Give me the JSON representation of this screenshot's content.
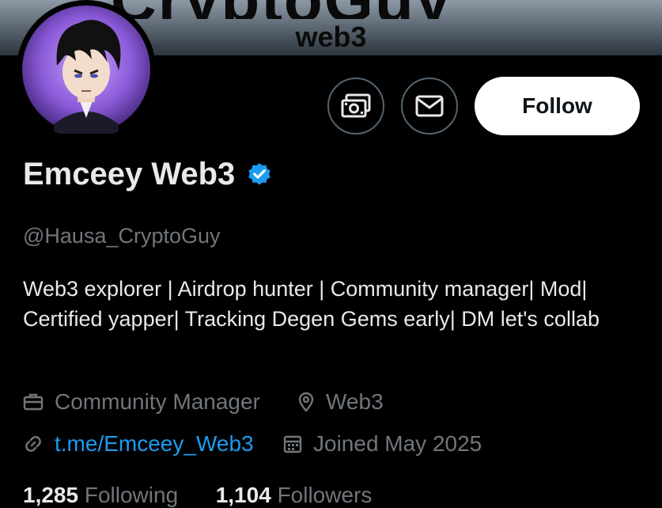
{
  "banner": {
    "headline": "CryptoGuy",
    "subtitle": "web3"
  },
  "profile": {
    "display_name": "Emceey Web3",
    "handle": "@Hausa_CryptoGuy",
    "bio": "Web3 explorer | Airdrop hunter | Community manager| Mod| Certified yapper| Tracking Degen Gems early| DM let's collab",
    "category": "Community Manager",
    "location": "Web3",
    "website": "t.me/Emceey_Web3",
    "joined": "Joined May 2025"
  },
  "actions": {
    "follow_label": "Follow"
  },
  "stats": {
    "following_count": "1,285",
    "following_label": "Following",
    "followers_count": "1,104",
    "followers_label": "Followers"
  },
  "icons": {
    "tip": "money-icon",
    "message": "envelope-icon",
    "verified": "verified-badge-icon",
    "category": "briefcase-icon",
    "location": "location-pin-icon",
    "website": "link-icon",
    "joined": "calendar-icon"
  },
  "colors": {
    "accent": "#1d9bf0",
    "muted": "#71767b",
    "text": "#e7e9ea",
    "background": "#000000",
    "border": "#536471"
  }
}
